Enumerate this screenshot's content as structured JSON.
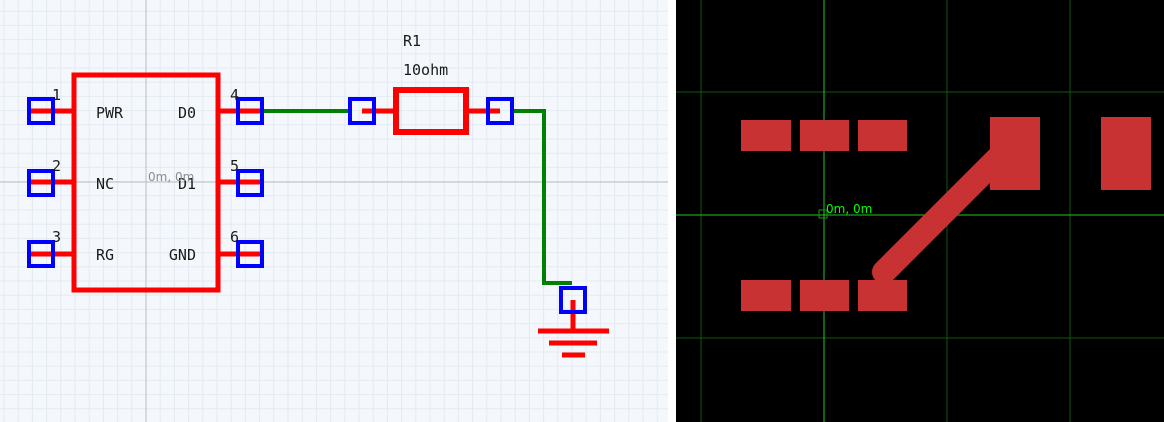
{
  "schematic": {
    "origin_label": "0m, 0m",
    "ic": {
      "pins": [
        {
          "number": "1",
          "label": "PWR"
        },
        {
          "number": "2",
          "label": "NC"
        },
        {
          "number": "3",
          "label": "RG"
        },
        {
          "number": "4",
          "label": "D0"
        },
        {
          "number": "5",
          "label": "D1"
        },
        {
          "number": "6",
          "label": "GND"
        }
      ]
    },
    "resistor": {
      "designator": "R1",
      "value": "10ohm"
    }
  },
  "pcb": {
    "origin_label": "0m, 0m"
  },
  "colors": {
    "schematic_background": "#f4f8fc",
    "grid_minor": "#e3eaf1",
    "grid_major": "#b8bec4",
    "component": "#ff0000",
    "pin": "#0000ff",
    "wire": "#008000",
    "pcb_background": "#000000",
    "pcb_grid": "#0d5a0d",
    "pcb_origin_axis": "#22c422",
    "pcb_copper": "#c83232",
    "pcb_origin_label": "#00ff00"
  }
}
